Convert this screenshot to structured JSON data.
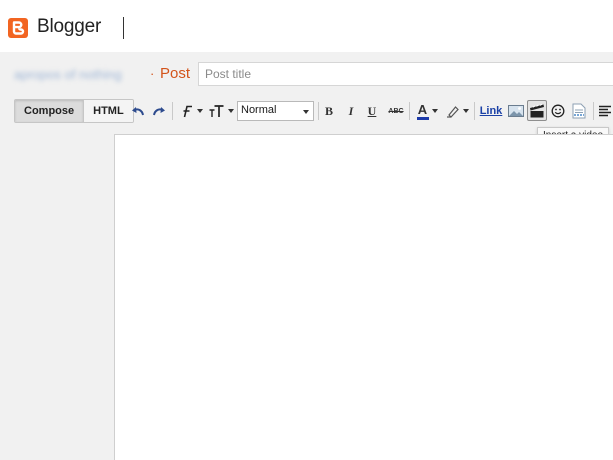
{
  "app": {
    "brand": "Blogger",
    "accent_color": "#f26522",
    "logo_icon": "blogger-logo-icon"
  },
  "breadcrumb": {
    "blog_name": "apropos of nothing",
    "separator": "·",
    "section": "Post"
  },
  "post": {
    "title_value": "",
    "title_placeholder": "Post title"
  },
  "editor_mode": {
    "tabs": [
      {
        "label": "Compose",
        "active": true
      },
      {
        "label": "HTML",
        "active": false
      }
    ]
  },
  "toolbar": {
    "undo_icon": "undo-icon",
    "redo_icon": "redo-icon",
    "font_icon": "font-family-icon",
    "font_size_icon": "font-size-icon",
    "format_selected": "Normal",
    "bold_label": "B",
    "italic_label": "I",
    "underline_label": "U",
    "strike_label": "ABC",
    "text_color_label": "A",
    "text_color": "#1c3aa9",
    "highlight_icon": "highlight-pen-icon",
    "link_label": "Link",
    "image_icon": "insert-image-icon",
    "video_icon": "insert-video-icon",
    "emoji_icon": "emoji-icon",
    "jump_break_icon": "jump-break-icon",
    "align_icon": "align-icon"
  },
  "tooltip": {
    "text": "Insert a video"
  }
}
